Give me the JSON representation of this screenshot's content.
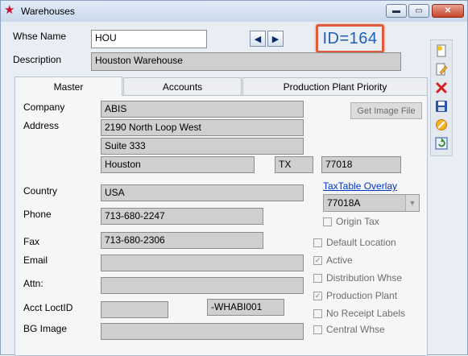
{
  "window": {
    "title": "Warehouses",
    "controls": {
      "minimize": "▬",
      "maximize": "▭",
      "close": "✕"
    }
  },
  "header": {
    "whse_name_label": "Whse Name",
    "whse_name_value": "HOU",
    "description_label": "Description",
    "description_value": "Houston Warehouse",
    "id_text": "ID=164",
    "nav_prev": "◀",
    "nav_next": "▶"
  },
  "tabs": [
    {
      "label": "Master",
      "active": true
    },
    {
      "label": "Accounts",
      "active": false
    },
    {
      "label": "Production Plant Priority",
      "active": false
    }
  ],
  "master": {
    "company_label": "Company",
    "company_value": "ABIS",
    "address_label": "Address",
    "address_line1": "2190 North Loop West",
    "address_line2": "Suite 333",
    "city": "Houston",
    "state": "TX",
    "zip": "77018",
    "country_label": "Country",
    "country_value": "USA",
    "phone_label": "Phone",
    "phone_value": "713-680-2247",
    "fax_label": "Fax",
    "fax_value": "713-680-2306",
    "email_label": "Email",
    "email_value": "",
    "attn_label": "Attn:",
    "attn_value": "",
    "acct_locid_label": "Acct LoctID",
    "acct_locid_value": "",
    "acct_locid_value2": "-WHABI001",
    "bg_image_label": "BG Image",
    "bg_image_value": "",
    "get_image_button": "Get Image File",
    "taxtable_link": "TaxTable Overlay",
    "taxtable_value": "77018A"
  },
  "checkboxes": [
    {
      "label": "Origin Tax",
      "checked": false
    },
    {
      "label": "Default Location",
      "checked": false
    },
    {
      "label": "Active",
      "checked": true
    },
    {
      "label": "Distribution Whse",
      "checked": false
    },
    {
      "label": "Production Plant",
      "checked": true
    },
    {
      "label": "No Receipt Labels",
      "checked": false
    },
    {
      "label": "Central Whse",
      "checked": false
    }
  ],
  "toolbar_icons": [
    "new-icon",
    "edit-icon",
    "delete-icon",
    "save-icon",
    "cancel-icon",
    "refresh-icon"
  ],
  "colors": {
    "id_border": "#e05a3c",
    "id_text": "#1f5fb5",
    "link": "#0033cc"
  }
}
